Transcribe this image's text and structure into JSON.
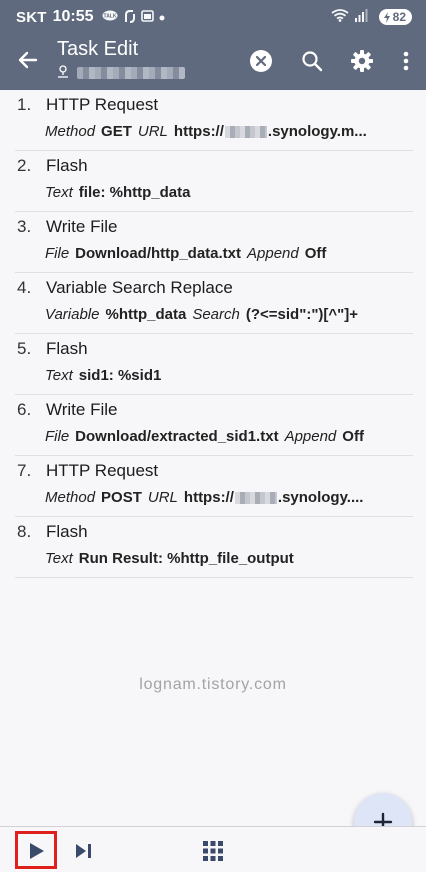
{
  "status_bar": {
    "carrier": "SKT",
    "time": "10:55",
    "battery": "82",
    "icons": [
      "talk-icon",
      "link-icon",
      "calendar-icon",
      "dot-icon",
      "wifi-icon",
      "signal-icon",
      "battery-icon"
    ]
  },
  "app_bar": {
    "title": "Task Edit",
    "subtitle_icon": "person-icon",
    "actions": [
      "close-icon",
      "search-icon",
      "gear-icon",
      "more-vert-icon"
    ],
    "background": "#5f6a7e"
  },
  "actions": [
    {
      "num": "1.",
      "name": "HTTP Request",
      "params": [
        {
          "k": "Method",
          "v": "GET"
        },
        {
          "k": "URL",
          "v_pre": "https://",
          "blurred": true,
          "v_post": ".synology.m..."
        }
      ]
    },
    {
      "num": "2.",
      "name": "Flash",
      "params": [
        {
          "k": "Text",
          "v": "file: %http_data"
        }
      ]
    },
    {
      "num": "3.",
      "name": "Write File",
      "params": [
        {
          "k": "File",
          "v": "Download/http_data.txt"
        },
        {
          "k": "Append",
          "v": "Off"
        }
      ]
    },
    {
      "num": "4.",
      "name": "Variable Search Replace",
      "params": [
        {
          "k": "Variable",
          "v": "%http_data"
        },
        {
          "k": "Search",
          "v": "(?<=sid\":\")[^\"]+"
        }
      ]
    },
    {
      "num": "5.",
      "name": "Flash",
      "params": [
        {
          "k": "Text",
          "v": "sid1: %sid1"
        }
      ]
    },
    {
      "num": "6.",
      "name": "Write File",
      "params": [
        {
          "k": "File",
          "v": "Download/extracted_sid1.txt"
        },
        {
          "k": "Append",
          "v": "Off"
        }
      ]
    },
    {
      "num": "7.",
      "name": "HTTP Request",
      "params": [
        {
          "k": "Method",
          "v": "POST"
        },
        {
          "k": "URL",
          "v_pre": "https://",
          "blurred": true,
          "v_post": ".synology...."
        }
      ]
    },
    {
      "num": "8.",
      "name": "Flash",
      "params": [
        {
          "k": "Text",
          "v": "Run Result: %http_file_output"
        }
      ]
    }
  ],
  "watermark": "lognam.tistory.com",
  "fab": {
    "icon": "plus-icon"
  },
  "bottom_bar": {
    "buttons": [
      "play-icon",
      "step-icon",
      "grid-icon"
    ],
    "highlight_color": "#e0201b"
  }
}
